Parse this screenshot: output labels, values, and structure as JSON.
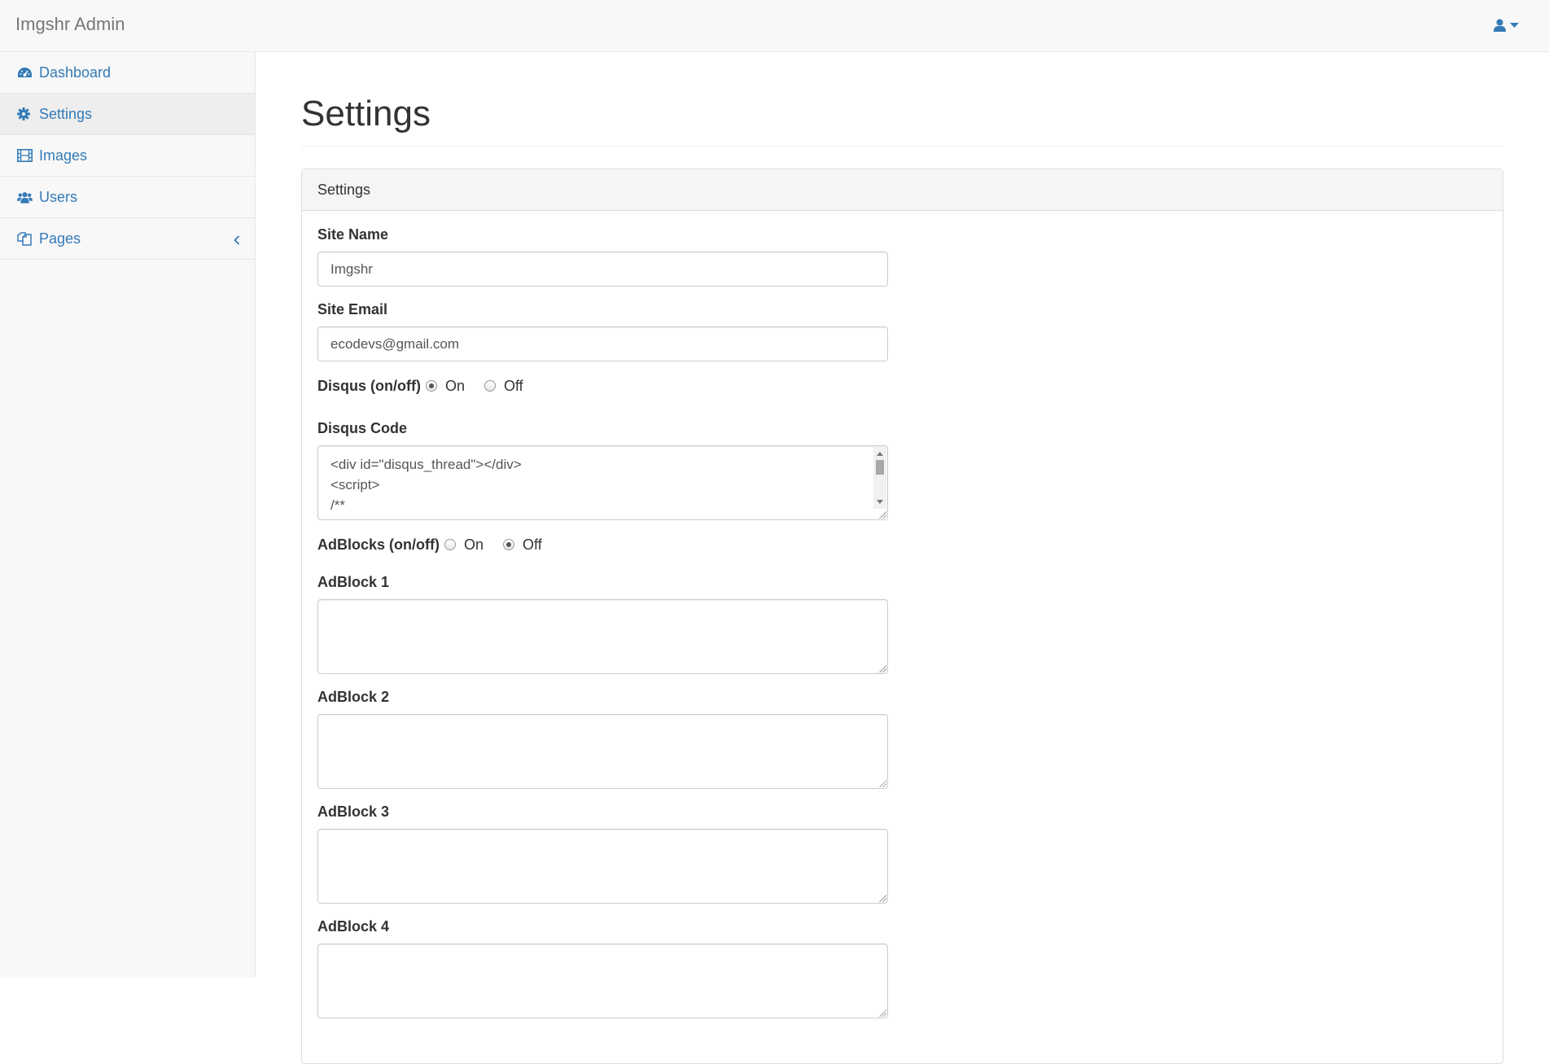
{
  "navbar": {
    "brand": "Imgshr Admin",
    "user_icon": "user-icon",
    "caret_icon": "caret-down-icon"
  },
  "sidebar": {
    "items": [
      {
        "label": "Dashboard",
        "icon": "dashboard-icon",
        "active": false
      },
      {
        "label": "Settings",
        "icon": "gear-icon",
        "active": true
      },
      {
        "label": "Images",
        "icon": "film-icon",
        "active": false
      },
      {
        "label": "Users",
        "icon": "users-icon",
        "active": false
      },
      {
        "label": "Pages",
        "icon": "pages-icon",
        "active": false,
        "chevron": "chevron-left-icon"
      }
    ]
  },
  "main": {
    "title": "Settings",
    "panel_heading": "Settings",
    "form": {
      "site_name_label": "Site Name",
      "site_name_value": "Imgshr",
      "site_email_label": "Site Email",
      "site_email_value": "ecodevs@gmail.com",
      "disqus_toggle_label": "Disqus (on/off)",
      "disqus_on": "On",
      "disqus_off": "Off",
      "disqus_selected": "On",
      "disqus_code_label": "Disqus Code",
      "disqus_code_value": "<div id=\"disqus_thread\"></div>\n<script>\n/**",
      "adblocks_toggle_label": "AdBlocks (on/off)",
      "adblocks_on": "On",
      "adblocks_off": "Off",
      "adblocks_selected": "Off",
      "adblock1_label": "AdBlock 1",
      "adblock2_label": "AdBlock 2",
      "adblock3_label": "AdBlock 3",
      "adblock4_label": "AdBlock 4"
    }
  },
  "colors": {
    "link": "#337ab7",
    "navbar_bg": "#f8f8f8",
    "border": "#e7e7e7"
  }
}
